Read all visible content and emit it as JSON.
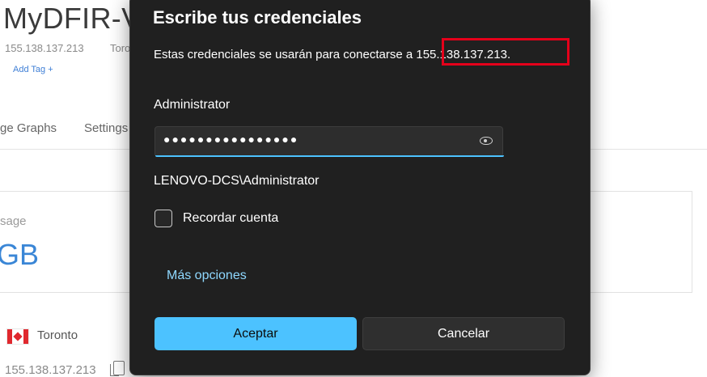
{
  "background": {
    "title": "MyDFIR-V",
    "ip": "155.138.137.213",
    "city_short": "Toron",
    "add_tag": "Add Tag +",
    "tab_graphs": "ge Graphs",
    "tab_settings": "Settings",
    "usage_label": "sage",
    "usage_value": "GB",
    "location": "Toronto",
    "ip_bottom": "155.138.137.213"
  },
  "dialog": {
    "title": "Escribe tus credenciales",
    "description": "Estas credenciales se usarán para conectarse a 155.138.137.213.",
    "username": "Administrator",
    "password_masked": "●●●●●●●●●●●●●●●●",
    "domain_user": "LENOVO-DCS\\Administrator",
    "remember_label": "Recordar cuenta",
    "more_options": "Más opciones",
    "accept_label": "Aceptar",
    "cancel_label": "Cancelar"
  },
  "colors": {
    "dialog_bg": "#202020",
    "accent": "#4cc2ff",
    "highlight": "#e4001a",
    "link": "#8fd8ff"
  },
  "icons": [
    "copy-icon",
    "eye-icon",
    "canada-flag-icon"
  ]
}
